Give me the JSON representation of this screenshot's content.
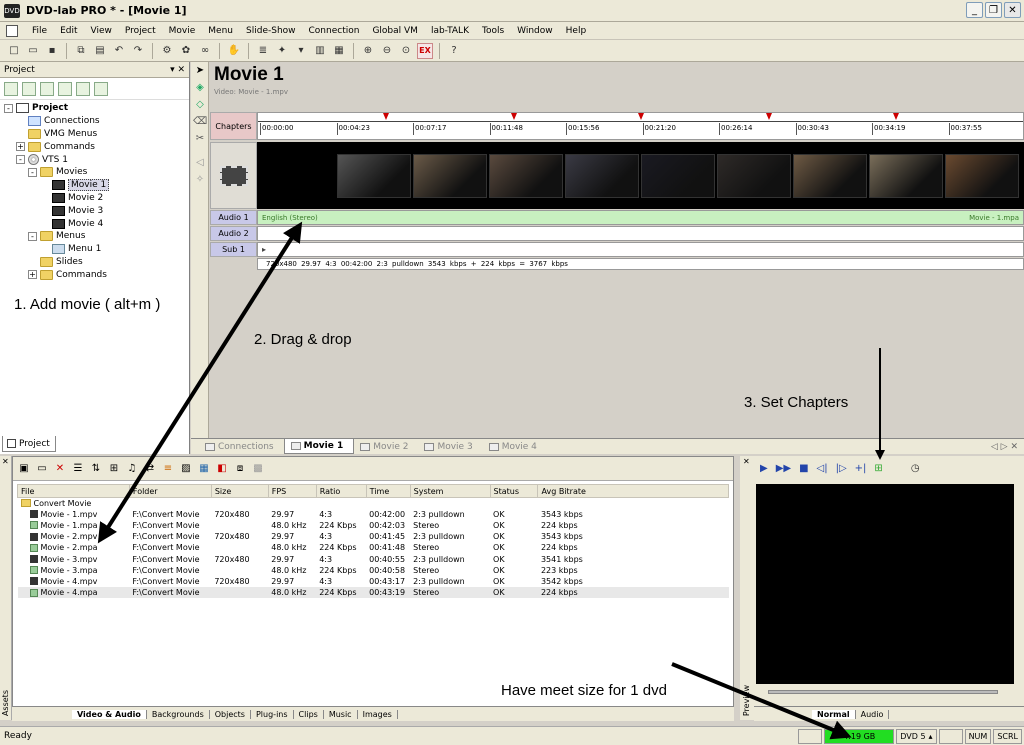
{
  "window": {
    "title": "DVD-lab PRO * - [Movie 1]",
    "buttons": [
      "_",
      "❐",
      "✕"
    ]
  },
  "menubar": [
    "File",
    "Edit",
    "View",
    "Project",
    "Movie",
    "Menu",
    "Slide-Show",
    "Connection",
    "Global VM",
    "lab-TALK",
    "Tools",
    "Window",
    "Help"
  ],
  "project_panel": {
    "title": "Project",
    "tab": "Project",
    "tree": [
      {
        "label": "Project",
        "level": 0,
        "icon": "proj",
        "expand": "-",
        "bold": true
      },
      {
        "label": "Connections",
        "level": 1,
        "icon": "conn",
        "expand": ""
      },
      {
        "label": "VMG Menus",
        "level": 1,
        "icon": "folder",
        "expand": ""
      },
      {
        "label": "Commands",
        "level": 1,
        "icon": "folder",
        "expand": "+"
      },
      {
        "label": "VTS 1",
        "level": 1,
        "icon": "disc",
        "expand": "-"
      },
      {
        "label": "Movies",
        "level": 2,
        "icon": "folder",
        "expand": "-"
      },
      {
        "label": "Movie 1",
        "level": 3,
        "icon": "film",
        "expand": "",
        "selected": true
      },
      {
        "label": "Movie 2",
        "level": 3,
        "icon": "film",
        "expand": ""
      },
      {
        "label": "Movie 3",
        "level": 3,
        "icon": "film",
        "expand": ""
      },
      {
        "label": "Movie 4",
        "level": 3,
        "icon": "film",
        "expand": ""
      },
      {
        "label": "Menus",
        "level": 2,
        "icon": "folder",
        "expand": "-"
      },
      {
        "label": "Menu 1",
        "level": 3,
        "icon": "menu",
        "expand": ""
      },
      {
        "label": "Slides",
        "level": 2,
        "icon": "folder",
        "expand": ""
      },
      {
        "label": "Commands",
        "level": 2,
        "icon": "folder",
        "expand": "+"
      }
    ]
  },
  "editor": {
    "title": "Movie 1",
    "subtitle": "Video: Movie - 1.mpv",
    "chapters_label": "Chapters",
    "timecodes": [
      "00:00:00",
      "00:04:23",
      "00:07:17",
      "00:11:48",
      "00:15:56",
      "00:21:20",
      "00:26:14",
      "00:30:43",
      "00:34:19",
      "00:37:55"
    ],
    "audio1_label": "Audio 1",
    "audio2_label": "Audio 2",
    "sub1_label": "Sub 1",
    "audio1_text": "English (Stereo)",
    "audio1_file": "Movie - 1.mpa",
    "info": "720x480   29.97   4:3   00:42:00   2:3 pulldown   3543 kbps + 224 kbps = 3767 kbps",
    "thumb_colors": [
      "#555",
      "#6a5a48",
      "#5a4a3e",
      "#3a3a44",
      "#1a1a22",
      "#2e2a28",
      "#6e5a44",
      "#7a6e5a",
      "#6a4a30"
    ],
    "tabs": [
      "Connections",
      "Movie 1",
      "Movie 2",
      "Movie 3",
      "Movie 4"
    ],
    "tab_nav": "◁ ▷ ✕"
  },
  "assets": {
    "strip_label": "Assets",
    "columns": [
      "File",
      "Folder",
      "Size",
      "FPS",
      "Ratio",
      "Time",
      "System",
      "Status",
      "Avg Bitrate"
    ],
    "group": "Convert Movie",
    "rows": [
      {
        "file": "Movie - 1.mpv",
        "type": "v",
        "folder": "F:\\Convert Movie",
        "size": "720x480",
        "fps": "29.97",
        "ratio": "4:3",
        "time": "00:42:00",
        "system": "2:3 pulldown",
        "status": "OK",
        "bitrate": "3543 kbps"
      },
      {
        "file": "Movie - 1.mpa",
        "type": "a",
        "folder": "F:\\Convert Movie",
        "size": "",
        "fps": "48.0 kHz",
        "ratio": "224 Kbps",
        "time": "00:42:03",
        "system": "Stereo",
        "status": "OK",
        "bitrate": "224 kbps"
      },
      {
        "file": "Movie - 2.mpv",
        "type": "v",
        "folder": "F:\\Convert Movie",
        "size": "720x480",
        "fps": "29.97",
        "ratio": "4:3",
        "time": "00:41:45",
        "system": "2:3 pulldown",
        "status": "OK",
        "bitrate": "3543 kbps"
      },
      {
        "file": "Movie - 2.mpa",
        "type": "a",
        "folder": "F:\\Convert Movie",
        "size": "",
        "fps": "48.0 kHz",
        "ratio": "224 Kbps",
        "time": "00:41:48",
        "system": "Stereo",
        "status": "OK",
        "bitrate": "224 kbps"
      },
      {
        "file": "Movie - 3.mpv",
        "type": "v",
        "folder": "F:\\Convert Movie",
        "size": "720x480",
        "fps": "29.97",
        "ratio": "4:3",
        "time": "00:40:55",
        "system": "2:3 pulldown",
        "status": "OK",
        "bitrate": "3541 kbps"
      },
      {
        "file": "Movie - 3.mpa",
        "type": "a",
        "folder": "F:\\Convert Movie",
        "size": "",
        "fps": "48.0 kHz",
        "ratio": "224 Kbps",
        "time": "00:40:58",
        "system": "Stereo",
        "status": "OK",
        "bitrate": "223 kbps"
      },
      {
        "file": "Movie - 4.mpv",
        "type": "v",
        "folder": "F:\\Convert Movie",
        "size": "720x480",
        "fps": "29.97",
        "ratio": "4:3",
        "time": "00:43:17",
        "system": "2:3 pulldown",
        "status": "OK",
        "bitrate": "3542 kbps"
      },
      {
        "file": "Movie - 4.mpa",
        "type": "a",
        "folder": "F:\\Convert Movie",
        "size": "",
        "fps": "48.0 kHz",
        "ratio": "224 Kbps",
        "time": "00:43:19",
        "system": "Stereo",
        "status": "OK",
        "bitrate": "224 kbps",
        "highlight": true
      }
    ],
    "tabs": [
      "Video & Audio",
      "Backgrounds",
      "Objects",
      "Plug-ins",
      "Clips",
      "Music",
      "Images"
    ]
  },
  "preview": {
    "strip_label": "Preview",
    "tabs": [
      "Normal",
      "Audio"
    ]
  },
  "statusbar": {
    "ready": "Ready",
    "size": "4.19 GB",
    "dvd": "DVD 5",
    "num": "NUM",
    "scrl": "SCRL"
  },
  "annotations": {
    "step1": "1. Add movie ( alt+m )",
    "step2": "2. Drag & drop",
    "step3": "3. Set Chapters",
    "note": "Have meet size for 1 dvd"
  }
}
